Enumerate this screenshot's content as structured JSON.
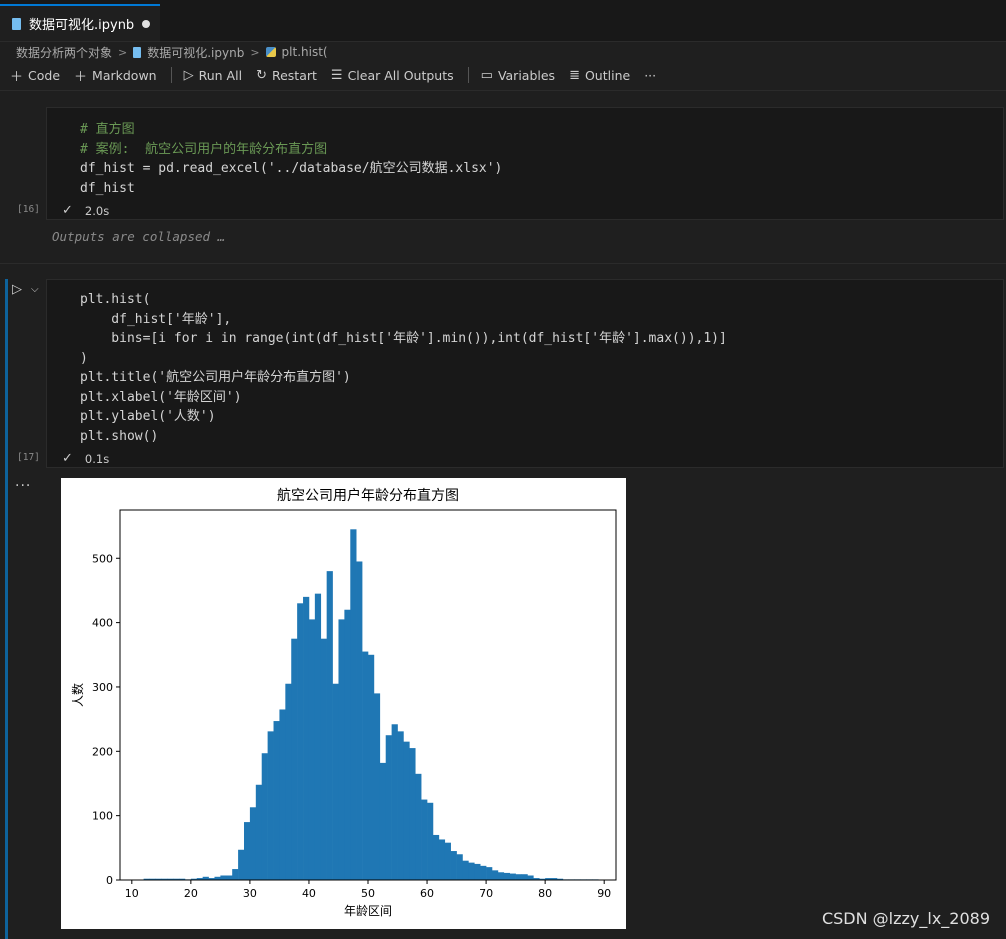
{
  "tab": {
    "title": "数据可视化.ipynb"
  },
  "breadcrumb": {
    "folder": "数据分析两个对象",
    "file": "数据可视化.ipynb",
    "symbol": "plt.hist("
  },
  "toolbar": {
    "code": "Code",
    "markdown": "Markdown",
    "run_all": "Run All",
    "restart": "Restart",
    "clear_outputs": "Clear All Outputs",
    "variables": "Variables",
    "outline": "Outline",
    "more": "···"
  },
  "cells": [
    {
      "exec_count": "[16]",
      "duration": "2.0s",
      "lines": [
        "# 直方图",
        "# 案例:  航空公司用户的年龄分布直方图",
        "df_hist = pd.read_excel('../database/航空公司数据.xlsx')",
        "df_hist"
      ],
      "outputs_collapsed": "Outputs are collapsed …"
    },
    {
      "exec_count": "[17]",
      "duration": "0.1s",
      "lines": [
        "plt.hist(",
        "    df_hist['年龄'],",
        "    bins=[i for i in range(int(df_hist['年龄'].min()),int(df_hist['年龄'].max()),1)]",
        ")",
        "plt.title('航空公司用户年龄分布直方图')",
        "plt.xlabel('年龄区间')",
        "plt.ylabel('人数')",
        "plt.show()"
      ]
    }
  ],
  "output_more": "···",
  "chart_data": {
    "type": "bar",
    "title": "航空公司用户年龄分布直方图",
    "xlabel": "年龄区间",
    "ylabel": "人数",
    "xlim": [
      8,
      92
    ],
    "ylim": [
      0,
      575
    ],
    "xticks": [
      10,
      20,
      30,
      40,
      50,
      60,
      70,
      80,
      90
    ],
    "yticks": [
      0,
      100,
      200,
      300,
      400,
      500
    ],
    "bin_start": 12,
    "bin_width": 1,
    "color": "#1f77b4",
    "values": [
      2,
      2,
      2,
      2,
      2,
      2,
      2,
      1,
      2,
      3,
      5,
      3,
      5,
      7,
      7,
      17,
      47,
      90,
      113,
      148,
      197,
      231,
      247,
      265,
      305,
      375,
      430,
      440,
      405,
      445,
      375,
      480,
      305,
      405,
      420,
      545,
      495,
      355,
      350,
      290,
      182,
      225,
      242,
      231,
      215,
      205,
      165,
      125,
      120,
      70,
      63,
      58,
      45,
      40,
      30,
      27,
      25,
      22,
      20,
      15,
      12,
      11,
      10,
      9,
      9,
      7,
      3,
      2,
      3,
      3,
      2,
      1,
      1,
      1,
      1,
      1,
      1
    ]
  },
  "watermark": "CSDN @lzzy_lx_2089"
}
